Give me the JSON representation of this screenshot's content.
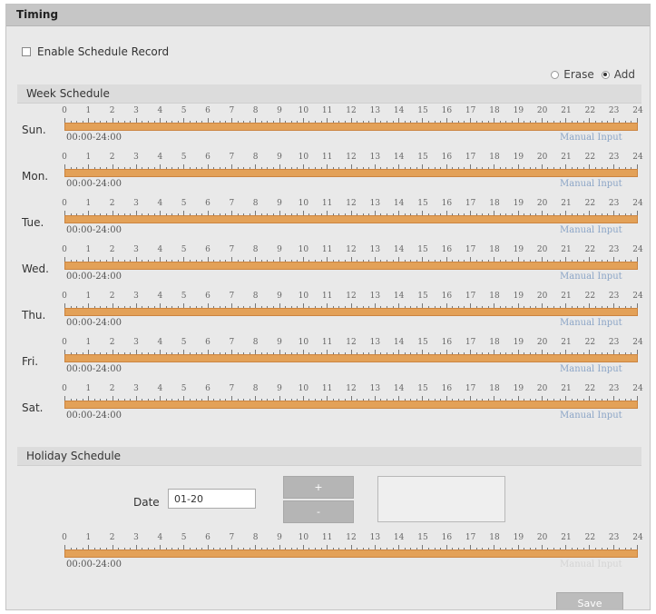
{
  "panel": {
    "title": "Timing"
  },
  "enable_schedule": {
    "label": "Enable Schedule Record",
    "checked": false
  },
  "mode": {
    "erase_label": "Erase",
    "add_label": "Add",
    "selected": "Add"
  },
  "week_schedule": {
    "title": "Week Schedule",
    "hours": [
      "0",
      "1",
      "2",
      "3",
      "4",
      "5",
      "6",
      "7",
      "8",
      "9",
      "10",
      "11",
      "12",
      "13",
      "14",
      "15",
      "16",
      "17",
      "18",
      "19",
      "20",
      "21",
      "22",
      "23",
      "24"
    ],
    "days": [
      {
        "label": "Sun.",
        "range": "00:00-24:00",
        "manual": "Manual Input"
      },
      {
        "label": "Mon.",
        "range": "00:00-24:00",
        "manual": "Manual Input"
      },
      {
        "label": "Tue.",
        "range": "00:00-24:00",
        "manual": "Manual Input"
      },
      {
        "label": "Wed.",
        "range": "00:00-24:00",
        "manual": "Manual Input"
      },
      {
        "label": "Thu.",
        "range": "00:00-24:00",
        "manual": "Manual Input"
      },
      {
        "label": "Fri.",
        "range": "00:00-24:00",
        "manual": "Manual Input"
      },
      {
        "label": "Sat.",
        "range": "00:00-24:00",
        "manual": "Manual Input"
      }
    ]
  },
  "holiday_schedule": {
    "title": "Holiday Schedule",
    "date_label": "Date",
    "date_value": "01-20",
    "add_label": "+",
    "remove_label": "-",
    "range": "00:00-24:00",
    "manual": "Manual Input"
  },
  "save_label": "Save",
  "colors": {
    "bar": "#e3a158",
    "bar_border": "#cb8440",
    "link": "#8aa4c6",
    "header": "#c6c6c6"
  }
}
